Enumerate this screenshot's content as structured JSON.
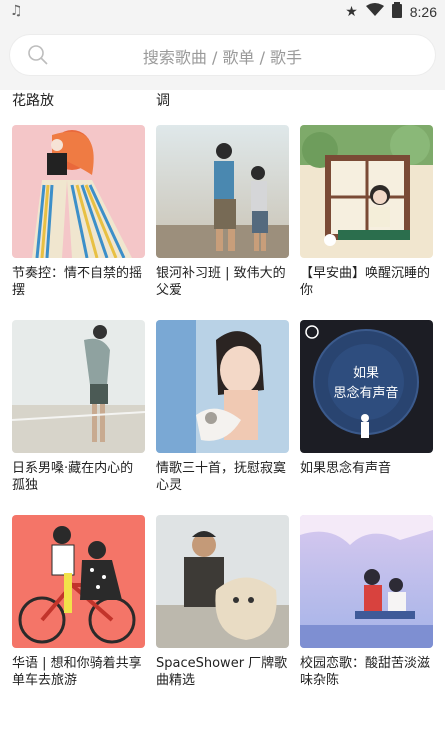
{
  "status_bar": {
    "time": "8:26",
    "music_icon": "music-note-icon",
    "star_icon": "star-icon",
    "wifi_icon": "wifi-icon",
    "battery_icon": "battery-icon"
  },
  "search": {
    "placeholder": "搜索歌曲 / 歌单 / 歌手",
    "icon": "search-icon"
  },
  "partial_row": [
    "花路放",
    "调"
  ],
  "playlists": [
    {
      "title": "节奏控：情不自禁的摇摆"
    },
    {
      "title": "银河补习班 | 致伟大的父爱"
    },
    {
      "title": "【早安曲】唤醒沉睡的你"
    },
    {
      "title": "日系男嗓·藏在内心的孤独"
    },
    {
      "title": "情歌三十首，抚慰寂寞心灵"
    },
    {
      "title": "如果思念有声音",
      "cover_text": "如果\n思念有声音"
    },
    {
      "title": "华语 | 想和你骑着共享单车去旅游"
    },
    {
      "title": "SpaceShower 厂牌歌曲精选"
    },
    {
      "title": "校园恋歌：酸甜苦淡滋味杂陈"
    }
  ],
  "colors": {
    "background": "#f4f4f4",
    "search_box": "#ffffff",
    "placeholder": "#9a9a9a"
  }
}
